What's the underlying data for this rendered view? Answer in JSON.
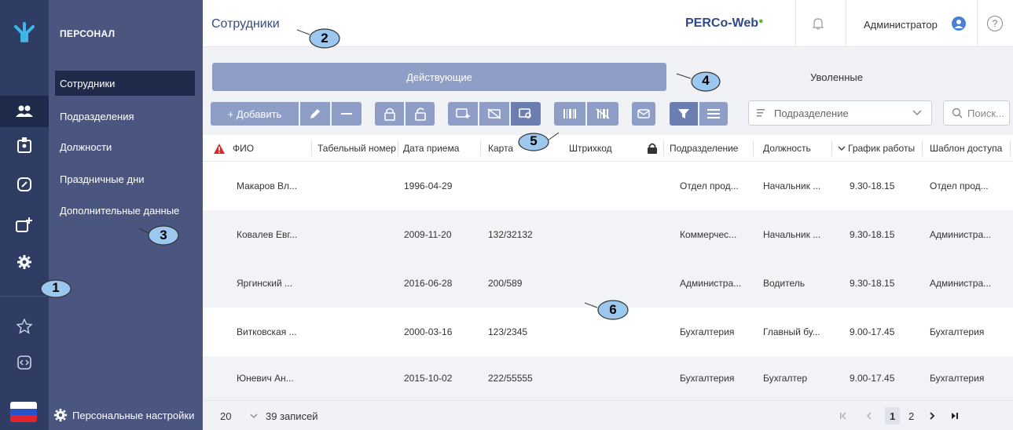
{
  "sidebar_rail": {
    "icons": [
      "logo-icon",
      "users-icon",
      "badge-icon",
      "link-icon",
      "badge-add-icon",
      "gear-icon",
      "star-icon",
      "code-icon",
      "flag-icon"
    ]
  },
  "nav": {
    "header": "ПЕРСОНАЛ",
    "items": [
      {
        "label": "Сотрудники",
        "active": true
      },
      {
        "label": "Подразделения",
        "active": false
      },
      {
        "label": "Должности",
        "active": false
      },
      {
        "label": "Праздничные дни",
        "active": false
      },
      {
        "label": "Дополнительные данные",
        "active": false
      }
    ],
    "footer_label": "Персональные настройки"
  },
  "header": {
    "title": "Сотрудники",
    "brand": "PERCo-Web",
    "user": "Администратор",
    "help": "?"
  },
  "tabs": {
    "active": "Действующие",
    "other": "Уволенные"
  },
  "toolbar": {
    "add_label": "+ Добавить",
    "department_placeholder": "Подразделение",
    "search_placeholder": "Поиск..."
  },
  "table": {
    "columns": [
      "ФИО",
      "Табельный номер",
      "Дата приема",
      "Карта",
      "Штрихкод",
      "Подразделение",
      "Должность",
      "График работы",
      "Шаблон доступа"
    ],
    "rows": [
      {
        "fio": "Макаров Вл...",
        "tab": "",
        "date": "1996-04-29",
        "card": "",
        "barcode": "",
        "dept": "Отдел прод...",
        "pos": "Начальник ...",
        "sched": "9.30-18.15",
        "tmpl": "Отдел прод..."
      },
      {
        "fio": "Ковалев Евг...",
        "tab": "",
        "date": "2009-11-20",
        "card": "132/32132",
        "barcode": "",
        "dept": "Коммерчес...",
        "pos": "Начальник ...",
        "sched": "9.30-18.15",
        "tmpl": "Администра..."
      },
      {
        "fio": "Яргинский ...",
        "tab": "",
        "date": "2016-06-28",
        "card": "200/589",
        "barcode": "",
        "dept": "Администра...",
        "pos": "Водитель",
        "sched": "9.30-18.15",
        "tmpl": "Администра..."
      },
      {
        "fio": "Витковская ...",
        "tab": "",
        "date": "2000-03-16",
        "card": "123/2345",
        "barcode": "",
        "dept": "Бухгалтерия",
        "pos": "Главный бу...",
        "sched": "9.00-17.45",
        "tmpl": "Бухгалтерия"
      },
      {
        "fio": "Юневич Ан...",
        "tab": "",
        "date": "2015-10-02",
        "card": "222/55555",
        "barcode": "",
        "dept": "Бухгалтерия",
        "pos": "Бухгалтер",
        "sched": "9.00-17.45",
        "tmpl": "Бухгалтерия"
      }
    ]
  },
  "footer": {
    "page_size": "20",
    "records": "39 записей",
    "pages": [
      "1",
      "2"
    ],
    "current_page": "1"
  },
  "callouts": [
    "1",
    "2",
    "3",
    "4",
    "5",
    "6"
  ],
  "colors": {
    "rail": "#2f3c63",
    "nav": "#4a5580",
    "accent": "#8e9ec7",
    "active_nav": "#1f2a4a",
    "brand_dot": "#5ab552"
  }
}
